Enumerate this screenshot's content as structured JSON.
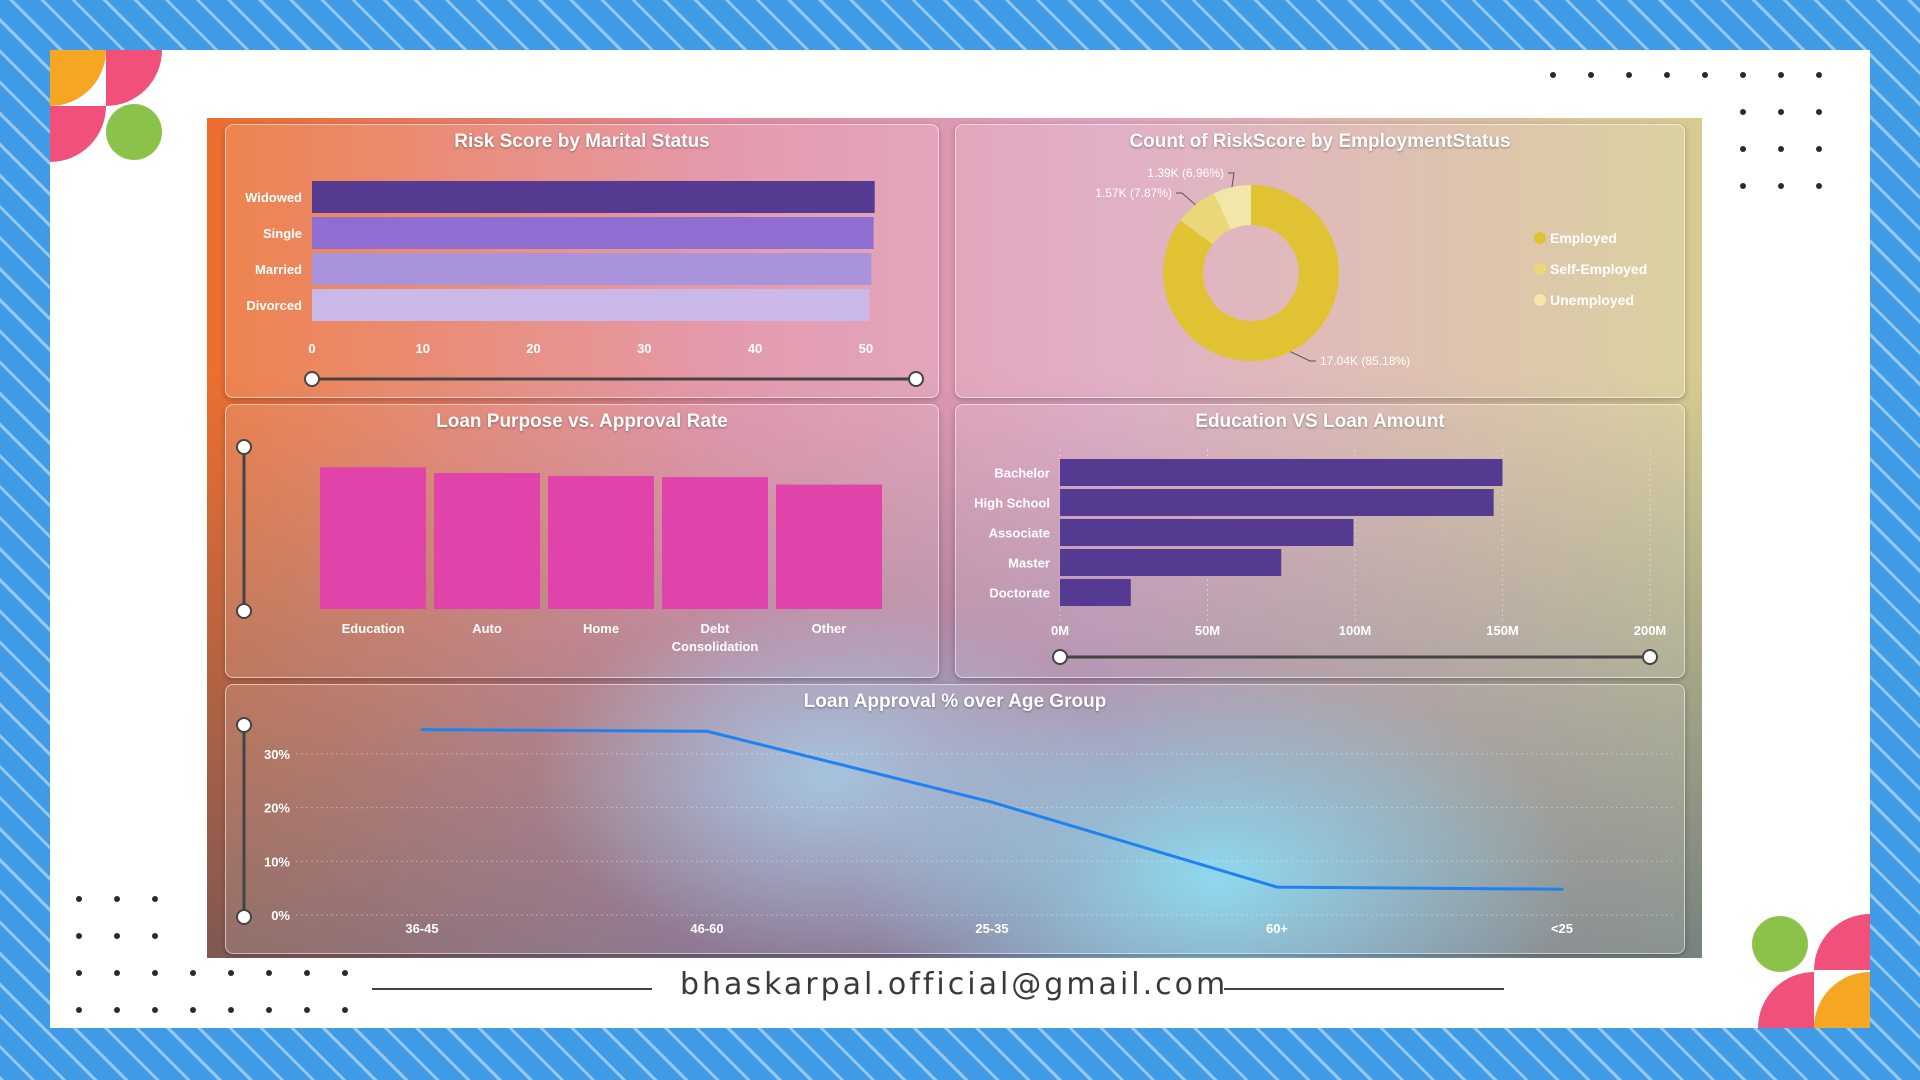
{
  "footer": {
    "email": "bhaskarpal.official@gmail.com"
  },
  "colors": {
    "purple_dark": "#553a91",
    "purple_mid": "#8e6ed0",
    "purple_light": "#a994dc",
    "purple_pale": "#c9b8e8",
    "pink": "#e043aa",
    "gold": "#e0c233",
    "gold_mid": "#ead77a",
    "gold_light": "#f2e6a8",
    "line_blue": "#1e82f0"
  },
  "charts": {
    "marital": {
      "title": "Risk Score by Marital Status"
    },
    "employment": {
      "title": "Count of RiskScore by EmploymentStatus"
    },
    "purpose": {
      "title": "Loan Purpose vs. Approval Rate"
    },
    "education": {
      "title": "Education VS Loan Amount"
    },
    "age": {
      "title": "Loan Approval % over Age Group"
    }
  },
  "chart_data": [
    {
      "id": "marital",
      "type": "bar",
      "orientation": "horizontal",
      "title": "Risk Score by Marital Status",
      "categories": [
        "Widowed",
        "Single",
        "Married",
        "Divorced"
      ],
      "values": [
        50.8,
        50.7,
        50.5,
        50.3
      ],
      "xlim": [
        0,
        52
      ],
      "xticks": [
        "0",
        "10",
        "20",
        "30",
        "40",
        "50"
      ],
      "bar_colors": [
        "#553a91",
        "#8e6ed0",
        "#a994dc",
        "#c9b8e8"
      ],
      "grid": false
    },
    {
      "id": "employment",
      "type": "pie",
      "style": "donut",
      "title": "Count of RiskScore by EmploymentStatus",
      "labels": [
        "Employed",
        "Self-Employed",
        "Unemployed"
      ],
      "values": [
        17040,
        1570,
        1390
      ],
      "data_labels": [
        "17.04K (85.18%)",
        "1.57K (7.87%)",
        "1.39K (6.96%)"
      ],
      "colors": [
        "#e0c233",
        "#ead77a",
        "#f2e6a8"
      ],
      "legend": "right"
    },
    {
      "id": "purpose",
      "type": "bar",
      "orientation": "vertical",
      "title": "Loan Purpose vs. Approval Rate",
      "categories": [
        "Education",
        "Auto",
        "Home",
        "Debt Consolidation",
        "Other"
      ],
      "values": [
        0.246,
        0.236,
        0.231,
        0.229,
        0.216
      ],
      "ylim": [
        0,
        0.25
      ],
      "bar_colors": [
        "#e043aa"
      ],
      "axis_labels_shown": false
    },
    {
      "id": "education",
      "type": "bar",
      "orientation": "horizontal",
      "title": "Education VS Loan Amount",
      "categories": [
        "Bachelor",
        "High School",
        "Associate",
        "Master",
        "Doctorate"
      ],
      "values": [
        150,
        147,
        99.5,
        75,
        24
      ],
      "unit": "M",
      "xlim": [
        0,
        200
      ],
      "xticks": [
        "0M",
        "50M",
        "100M",
        "150M",
        "200M"
      ],
      "bar_colors": [
        "#553a91"
      ],
      "grid": true
    },
    {
      "id": "age",
      "type": "line",
      "title": "Loan Approval % over Age Group",
      "categories": [
        "36-45",
        "46-60",
        "25-35",
        "60+",
        "<25"
      ],
      "values": [
        34.5,
        34.2,
        21,
        5.2,
        4.8
      ],
      "ylim": [
        0,
        35
      ],
      "yticks": [
        "0%",
        "10%",
        "20%",
        "30%"
      ],
      "line_color": "#1e82f0",
      "grid": true
    }
  ]
}
